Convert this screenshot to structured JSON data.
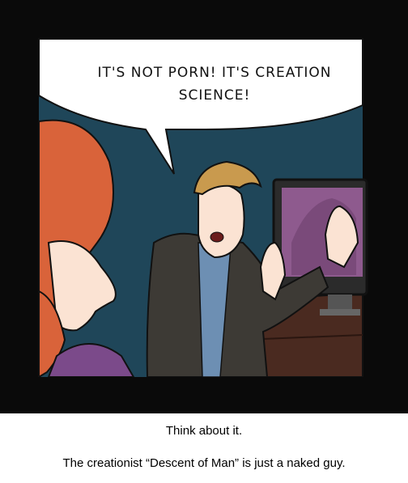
{
  "comic": {
    "speech_bubble": {
      "line1": "IT'S NOT PORN! IT'S CREATION",
      "line2": "SCIENCE!"
    },
    "caption": {
      "line1": "Think about it.",
      "line2": "The creationist “Descent of Man” is just a naked guy."
    },
    "colors": {
      "background_wall": "#1f4659",
      "hair_woman": "#d9633a",
      "hair_man": "#c99a4e",
      "jacket": "#3d3a35",
      "shirt": "#6d8fb3",
      "monitor_screen": "#8e5a8e",
      "desk": "#4a2a20"
    }
  }
}
